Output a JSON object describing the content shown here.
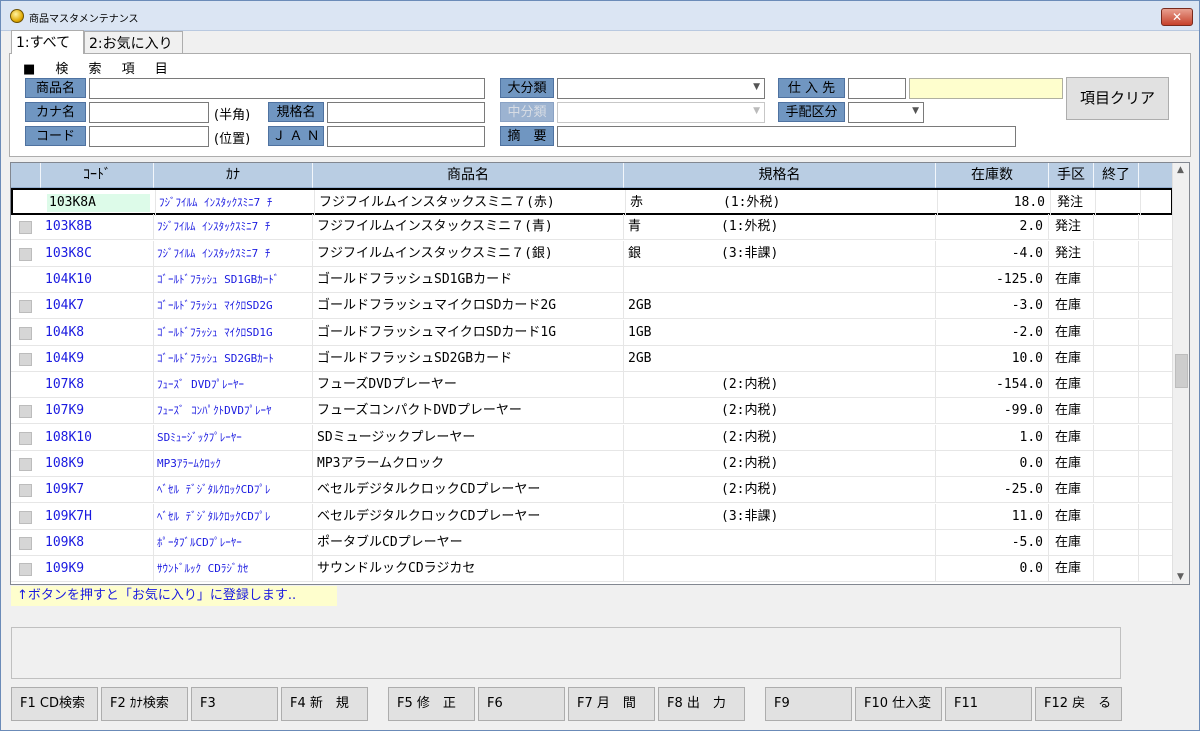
{
  "window": {
    "title": "商品マスタメンテナンス",
    "close_label": "✕"
  },
  "tabs": [
    {
      "label": "1:すべて"
    },
    {
      "label": "2:お気に入り"
    }
  ],
  "search": {
    "section_label": "■ 検 索 項 目",
    "fields": {
      "product_name": {
        "label": "商品名",
        "value": ""
      },
      "kana_name": {
        "label": "カナ名",
        "value": "",
        "suffix": "(半角)"
      },
      "code": {
        "label": "コード",
        "value": "",
        "suffix": "(位置)"
      },
      "spec_name": {
        "label": "規格名",
        "value": ""
      },
      "jan": {
        "label": "Ｊ Ａ Ｎ",
        "value": ""
      },
      "major_category": {
        "label": "大分類",
        "value": ""
      },
      "minor_category": {
        "label": "中分類",
        "value": ""
      },
      "summary": {
        "label": "摘　要",
        "value": ""
      },
      "supplier": {
        "label": "仕 入 先",
        "code_value": "",
        "name_value": ""
      },
      "order_type": {
        "label": "手配区分",
        "value": ""
      }
    },
    "clear_button": "項目クリア"
  },
  "grid": {
    "columns": [
      "ｺｰﾄﾞ",
      "ｶﾅ",
      "商品名",
      "規格名",
      "在庫数",
      "手区",
      "終了"
    ],
    "rows": [
      {
        "code": "103K8A",
        "kana": "ﾌｼﾞﾌｲﾙﾑ ｲﾝｽﾀｯｸｽﾐﾆ7 ﾁ",
        "name": "フジフイルムインスタックスミニ７(赤)",
        "spec": "赤",
        "tax": "(1:外税)",
        "stock": "18.0",
        "te": "発注",
        "end": "",
        "has_check": false,
        "selected": true
      },
      {
        "code": "103K8B",
        "kana": "ﾌｼﾞﾌｲﾙﾑ ｲﾝｽﾀｯｸｽﾐﾆ7 ﾁ",
        "name": "フジフイルムインスタックスミニ７(青)",
        "spec": "青",
        "tax": "(1:外税)",
        "stock": "2.0",
        "te": "発注",
        "end": "",
        "has_check": true,
        "selected": false
      },
      {
        "code": "103K8C",
        "kana": "ﾌｼﾞﾌｲﾙﾑ ｲﾝｽﾀｯｸｽﾐﾆ7 ﾁ",
        "name": "フジフイルムインスタックスミニ７(銀)",
        "spec": "銀",
        "tax": "(3:非課)",
        "stock": "-4.0",
        "te": "発注",
        "end": "",
        "has_check": true,
        "selected": false
      },
      {
        "code": "104K10",
        "kana": "ｺﾞｰﾙﾄﾞﾌﾗｯｼｭ SD1GBｶｰﾄﾞ",
        "name": "ゴールドフラッシュSD1GBカード",
        "spec": "",
        "tax": "",
        "stock": "-125.0",
        "te": "在庫",
        "end": "",
        "has_check": false,
        "selected": false
      },
      {
        "code": "104K7",
        "kana": "ｺﾞｰﾙﾄﾞﾌﾗｯｼｭ ﾏｲｸﾛSD2G",
        "name": "ゴールドフラッシュマイクロSDカード2G",
        "spec": "2GB",
        "tax": "",
        "stock": "-3.0",
        "te": "在庫",
        "end": "",
        "has_check": true,
        "selected": false
      },
      {
        "code": "104K8",
        "kana": "ｺﾞｰﾙﾄﾞﾌﾗｯｼｭ ﾏｲｸﾛSD1G",
        "name": "ゴールドフラッシュマイクロSDカード1G",
        "spec": "1GB",
        "tax": "",
        "stock": "-2.0",
        "te": "在庫",
        "end": "",
        "has_check": true,
        "selected": false
      },
      {
        "code": "104K9",
        "kana": "ｺﾞｰﾙﾄﾞﾌﾗｯｼｭ SD2GBｶｰﾄ",
        "name": "ゴールドフラッシュSD2GBカード",
        "spec": "2GB",
        "tax": "",
        "stock": "10.0",
        "te": "在庫",
        "end": "",
        "has_check": true,
        "selected": false
      },
      {
        "code": "107K8",
        "kana": "ﾌｭｰｽﾞ DVDﾌﾟﾚｰﾔｰ",
        "name": "フューズDVDプレーヤー",
        "spec": "",
        "tax": "(2:内税)",
        "stock": "-154.0",
        "te": "在庫",
        "end": "",
        "has_check": false,
        "selected": false
      },
      {
        "code": "107K9",
        "kana": "ﾌｭｰｽﾞ ｺﾝﾊﾟｸﾄDVDﾌﾟﾚｰﾔ",
        "name": "フューズコンパクトDVDプレーヤー",
        "spec": "",
        "tax": "(2:内税)",
        "stock": "-99.0",
        "te": "在庫",
        "end": "",
        "has_check": true,
        "selected": false
      },
      {
        "code": "108K10",
        "kana": "SDﾐｭｰｼﾞｯｸﾌﾟﾚｰﾔｰ",
        "name": "SDミュージックプレーヤー",
        "spec": "",
        "tax": "(2:内税)",
        "stock": "1.0",
        "te": "在庫",
        "end": "",
        "has_check": true,
        "selected": false
      },
      {
        "code": "108K9",
        "kana": "MP3ｱﾗｰﾑｸﾛｯｸ",
        "name": "MP3アラームクロック",
        "spec": "",
        "tax": "(2:内税)",
        "stock": "0.0",
        "te": "在庫",
        "end": "",
        "has_check": true,
        "selected": false
      },
      {
        "code": "109K7",
        "kana": "ﾍﾞｾﾙ ﾃﾞｼﾞﾀﾙｸﾛｯｸCDﾌﾟﾚ",
        "name": "ベセルデジタルクロックCDプレーヤー",
        "spec": "",
        "tax": "(2:内税)",
        "stock": "-25.0",
        "te": "在庫",
        "end": "",
        "has_check": true,
        "selected": false
      },
      {
        "code": "109K7H",
        "kana": "ﾍﾞｾﾙ ﾃﾞｼﾞﾀﾙｸﾛｯｸCDﾌﾟﾚ",
        "name": "ベセルデジタルクロックCDプレーヤー",
        "spec": "",
        "tax": "(3:非課)",
        "stock": "11.0",
        "te": "在庫",
        "end": "",
        "has_check": true,
        "selected": false
      },
      {
        "code": "109K8",
        "kana": "ﾎﾟｰﾀﾌﾞﾙCDﾌﾟﾚｰﾔｰ",
        "name": "ポータブルCDプレーヤー",
        "spec": "",
        "tax": "",
        "stock": "-5.0",
        "te": "在庫",
        "end": "",
        "has_check": true,
        "selected": false
      },
      {
        "code": "109K9",
        "kana": "ｻｳﾝﾄﾞﾙｯｸ CDﾗｼﾞｶｾ",
        "name": "サウンドルックCDラジカセ",
        "spec": "",
        "tax": "",
        "stock": "0.0",
        "te": "在庫",
        "end": "",
        "has_check": true,
        "selected": false
      }
    ]
  },
  "hint": "↑ボタンを押すと「お気に入り」に登録します..",
  "function_keys": [
    {
      "label": "F1 CD検索"
    },
    {
      "label": "F2 ｶﾅ検索"
    },
    {
      "label": "F3"
    },
    {
      "label": "F4 新　規"
    },
    {
      "label": "F5 修　正"
    },
    {
      "label": "F6"
    },
    {
      "label": "F7 月　間"
    },
    {
      "label": "F8 出　力"
    },
    {
      "label": "F9"
    },
    {
      "label": "F10 仕入変"
    },
    {
      "label": "F11"
    },
    {
      "label": "F12 戻　る"
    }
  ],
  "colors": {
    "label_bg": "#7096c1",
    "header_bg": "#b9cde3",
    "link_text": "#1a1ae0",
    "hint_bg": "#fefecd",
    "edit_bg": "#ddfbe9"
  }
}
